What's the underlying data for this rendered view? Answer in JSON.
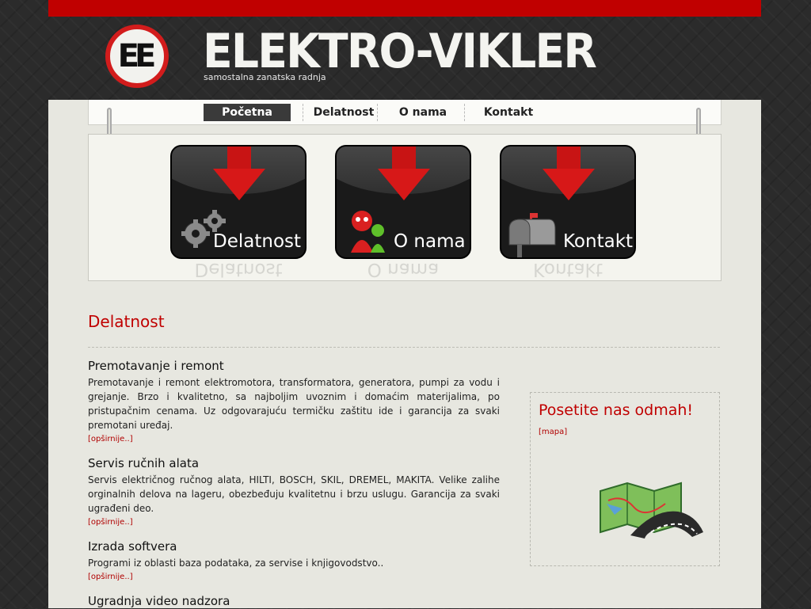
{
  "header": {
    "logo_monogram": "EE",
    "brand_name": "ELEKTRO-VIKLER",
    "tagline": "samostalna zanatska radnja"
  },
  "nav": {
    "items": [
      {
        "label": "Početna",
        "active": true
      },
      {
        "label": "Delatnost",
        "active": false
      },
      {
        "label": "O nama",
        "active": false
      },
      {
        "label": "Kontakt",
        "active": false
      }
    ]
  },
  "banner": {
    "tiles": [
      {
        "label": "Delatnost",
        "icon": "gears-icon"
      },
      {
        "label": "O nama",
        "icon": "people-icon"
      },
      {
        "label": "Kontakt",
        "icon": "mailbox-icon"
      }
    ]
  },
  "content": {
    "title": "Delatnost",
    "services": [
      {
        "title": "Premotavanje i remont",
        "text": "Premotavanje i remont elektromotora, transformatora, generatora, pumpi za vodu i grejanje. Brzo i kvalitetno, sa najboljim uvoznim i domaćim materijalima, po pristupačnim cenama. Uz odgovarajuću termičku zaštitu ide i garancija za svaki premotani uređaj.",
        "more": "[opširnije..]"
      },
      {
        "title": "Servis ručnih alata",
        "text": "Servis električnog ručnog alata, HILTI, BOSCH, SKIL, DREMEL, MAKITA. Velike zalihe orginalnih delova na lageru, obezbeđuju kvalitetnu i brzu uslugu. Garancija za svaki ugrađeni deo.",
        "more": "[opširnije..]"
      },
      {
        "title": "Izrada softvera",
        "text": "Programi iz oblasti baza podataka, za servise i knjigovodstvo..",
        "more": "[opširnije..]"
      },
      {
        "title": "Ugradnja video nadzora",
        "text": "",
        "more": ""
      }
    ]
  },
  "sidebar": {
    "title": "Posetite nas odmah!",
    "map_link": "[mapa]",
    "map_icon": "map-icon"
  },
  "colors": {
    "accent": "#c00000",
    "page_bg": "#e7e7e0",
    "outer_bg": "#2b2b2b"
  }
}
